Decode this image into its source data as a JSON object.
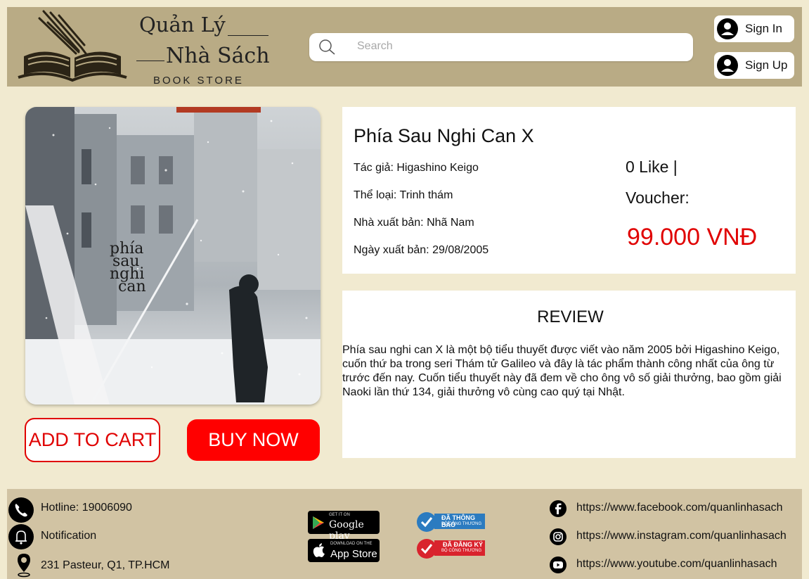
{
  "header": {
    "logo_line1": "Quản Lý",
    "logo_line2": "Nhà Sách",
    "logo_sub": "BOOK STORE",
    "search_placeholder": "Search",
    "signin_label": "Sign In",
    "signup_label": "Sign Up"
  },
  "product": {
    "title": "Phía Sau Nghi Can X",
    "author": "Tác giả:  Higashino Keigo",
    "genre": "Thể loại: Trinh thám",
    "publisher": "Nhà xuất bản: Nhã Nam",
    "publish_date": "Ngày xuất bản: 29/08/2005",
    "likes": "0 Like |",
    "voucher": "Voucher:",
    "price": "99.000 VNĐ",
    "cover_text": [
      "phía",
      "sau",
      "nghi",
      "can"
    ],
    "add_to_cart": "ADD TO CART",
    "buy_now": "BUY NOW"
  },
  "review": {
    "heading": "REVIEW",
    "body": "Phía sau nghi can X là một bộ tiểu thuyết được viết vào năm 2005 bởi Higashino Keigo, cuốn thứ ba trong seri Thám tử Galileo và đây là tác phẩm thành công nhất của ông từ trước đến nay. Cuốn tiểu thuyết này đã đem về cho ông vô số giải thưởng, bao gồm giải Naoki lần thứ 134, giải thưởng vô cùng cao quý tại Nhật."
  },
  "footer": {
    "hotline": "Hotline: 19006090",
    "notification": "Notification",
    "address": "231 Pasteur, Q1, TP.HCM",
    "google_play_small": "GET IT ON",
    "google_play": "Google play",
    "app_store_small": "DOWNLOAD ON THE",
    "app_store": "App Store",
    "badge1": "ĐÃ THÔNG BÁO",
    "badge1_sub": "BỘ CÔNG THƯƠNG",
    "badge2": "ĐÃ ĐĂNG KÝ",
    "badge2_sub": "BỘ CÔNG THƯƠNG",
    "facebook": "https://www.facebook.com/quanlinhasach",
    "instagram": "https://www.instagram.com/quanlinhasach",
    "youtube": "https://www.youtube.com/quanlinhasach"
  },
  "colors": {
    "page_bg": "#f1ead0",
    "header_bg": "#b9ab85",
    "footer_bg": "#d1c3a3",
    "accent_red": "#ff0000",
    "badge_blue": "#2b7bc0",
    "badge_red": "#d9232d"
  }
}
